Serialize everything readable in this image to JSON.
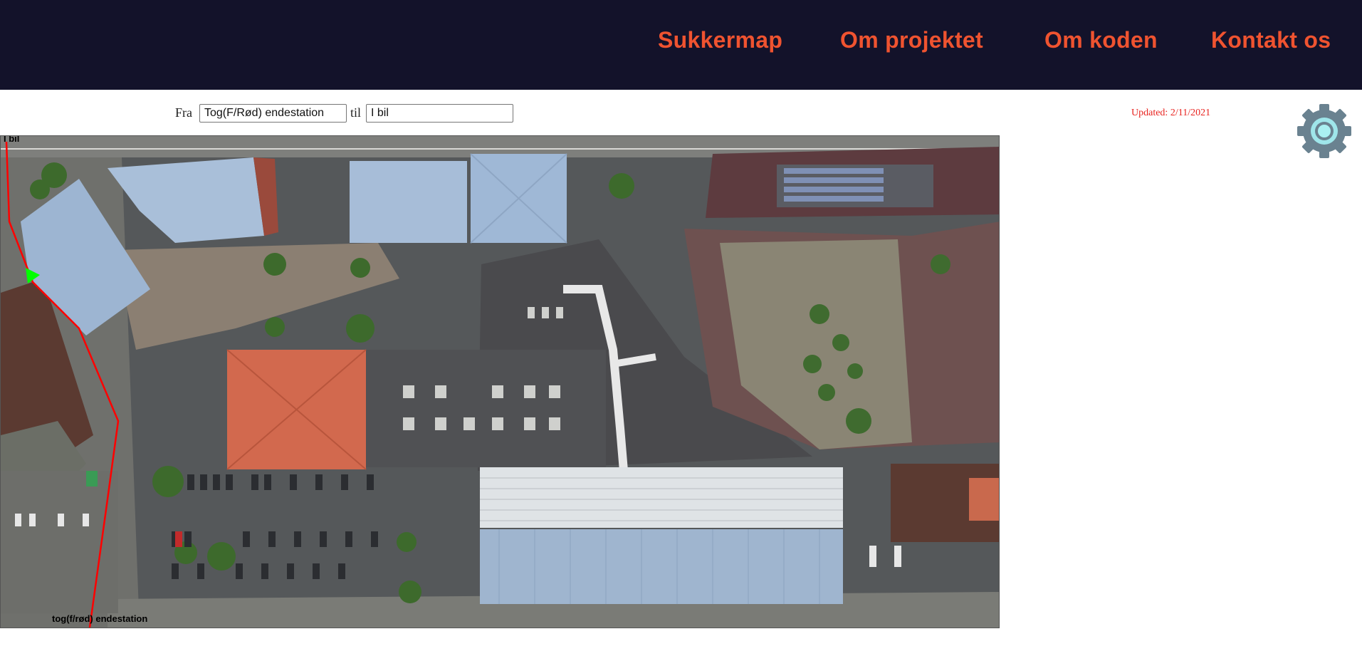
{
  "nav": {
    "items": [
      "Sukkermap",
      "Om projektet",
      "Om koden",
      "Kontakt os"
    ]
  },
  "route": {
    "from_label": "Fra",
    "from_value": "Tog(F/Rød) endestation",
    "to_label": "til",
    "to_value": "I bil"
  },
  "updated": "Updated: 2/11/2021",
  "map": {
    "route_start_label": "tog(f/rød) endestation",
    "route_end_label": "I bil",
    "route_color": "#ff0000",
    "direction_marker_color": "#00ff00"
  },
  "colors": {
    "header_bg": "#13122a",
    "nav_text": "#ef5330",
    "updated_text": "#e8231f",
    "gear": "#6a8290"
  },
  "icons": {
    "settings": "gear-icon"
  }
}
